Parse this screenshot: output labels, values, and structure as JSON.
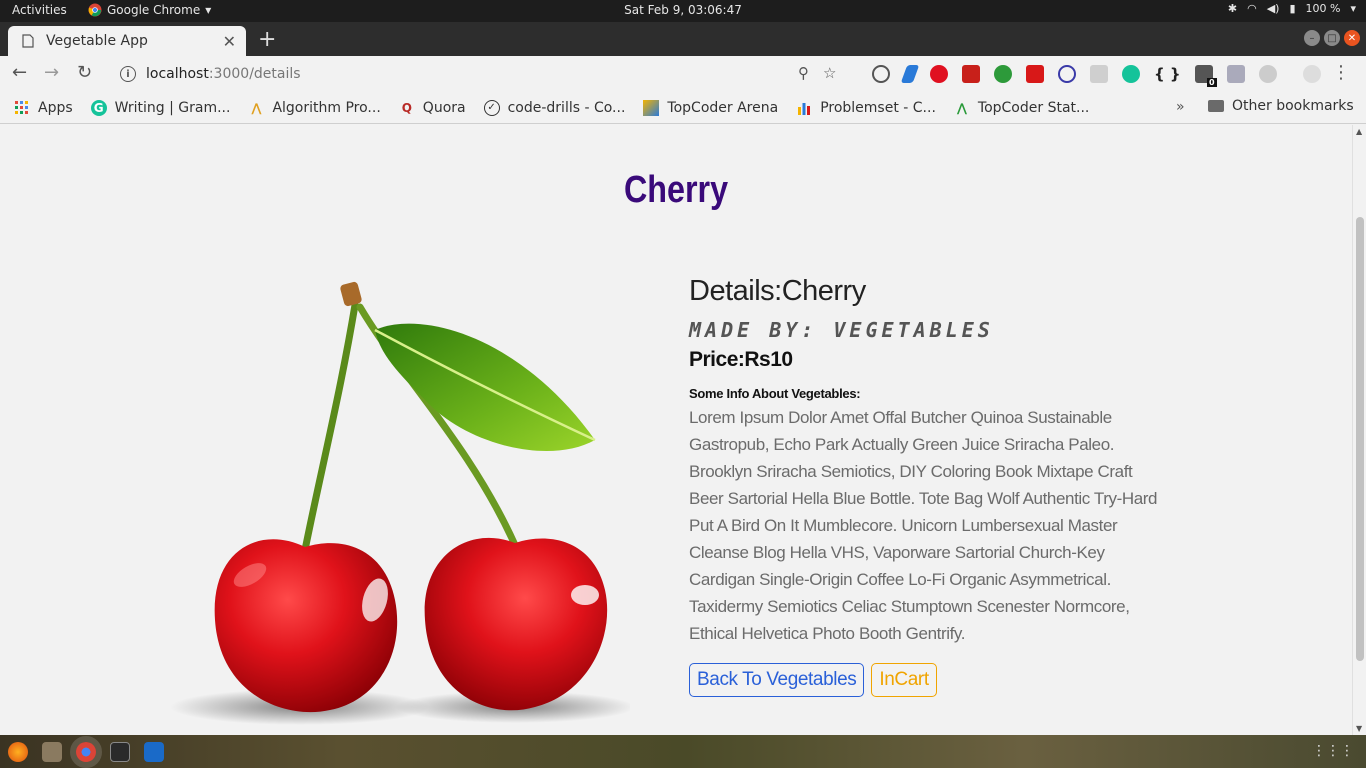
{
  "topbar": {
    "activities": "Activities",
    "app_name": "Google Chrome",
    "clock": "Sat Feb  9, 03:06:47",
    "battery": "100 %"
  },
  "browser": {
    "tab_title": "Vegetable App",
    "url_host": "localhost",
    "url_path": ":3000/details",
    "extension_badge": "0"
  },
  "bookmarks": {
    "items": [
      {
        "label": "Apps",
        "icon": "apps-grid-icon"
      },
      {
        "label": "Writing | Gram...",
        "icon": "grammarly-icon"
      },
      {
        "label": "Algorithm Pro...",
        "icon": "algorithm-icon"
      },
      {
        "label": "Quora",
        "icon": "quora-icon"
      },
      {
        "label": "code-drills - Co...",
        "icon": "check-circle-icon"
      },
      {
        "label": "TopCoder Arena",
        "icon": "topcoder-icon"
      },
      {
        "label": "Problemset - C...",
        "icon": "codeforces-icon"
      },
      {
        "label": "TopCoder Stat...",
        "icon": "topcoder-stat-icon"
      }
    ],
    "more": "»",
    "other": "Other bookmarks"
  },
  "product": {
    "title": "Cherry",
    "details_heading": "Details:Cherry",
    "made_by": "Made By: Vegetables",
    "price": "Price:Rs10",
    "info_label": "Some Info About Vegetables:",
    "info_text": "Lorem Ipsum Dolor Amet Offal Butcher Quinoa Sustainable Gastropub, Echo Park Actually Green Juice Sriracha Paleo. Brooklyn Sriracha Semiotics, DIY Coloring Book Mixtape Craft Beer Sartorial Hella Blue Bottle. Tote Bag Wolf Authentic Try-Hard Put A Bird On It Mumblecore. Unicorn Lumbersexual Master Cleanse Blog Hella VHS, Vaporware Sartorial Church-Key Cardigan Single-Origin Coffee Lo-Fi Organic Asymmetrical. Taxidermy Semiotics Celiac Stumptown Scenester Normcore, Ethical Helvetica Photo Booth Gentrify.",
    "image": "cherry-image"
  },
  "actions": {
    "back_label": "Back To Vegetables",
    "incart_label": "InCart"
  },
  "colors": {
    "title": "#3a0a7a",
    "back_button": "#2a60d8",
    "incart_button": "#f0a400",
    "cherry_red": "#d8121a",
    "leaf_green": "#5aa012"
  }
}
